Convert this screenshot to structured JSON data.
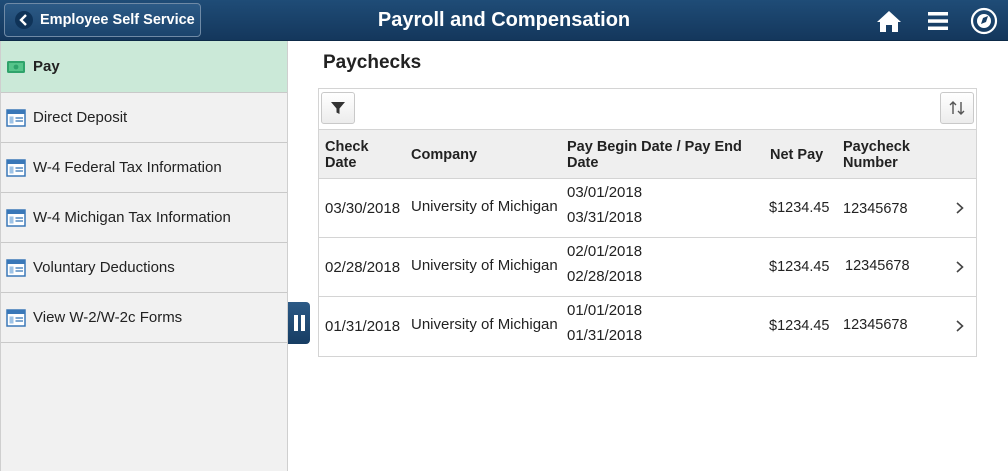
{
  "header": {
    "back_label": "Employee Self Service",
    "title": "Payroll and Compensation",
    "icons": [
      "home-icon",
      "menu-icon",
      "navbar-icon"
    ],
    "bg_color": "#1a4570"
  },
  "sidebar": {
    "items": [
      {
        "label": "Pay",
        "icon": "money-icon",
        "active": true
      },
      {
        "label": "Direct Deposit",
        "icon": "page-icon"
      },
      {
        "label": "W-4 Federal Tax Information",
        "icon": "page-icon"
      },
      {
        "label": "W-4 Michigan Tax Information",
        "icon": "page-icon"
      },
      {
        "label": "Voluntary Deductions",
        "icon": "page-icon"
      },
      {
        "label": "View W-2/W-2c Forms",
        "icon": "page-icon"
      }
    ],
    "active_color": "#cbe9d8"
  },
  "main": {
    "title": "Paychecks",
    "columns": {
      "check_date": "Check Date",
      "company": "Company",
      "pay_dates": "Pay Begin Date / Pay End Date",
      "net_pay": "Net Pay",
      "paycheck_number": "Paycheck Number"
    },
    "rows": [
      {
        "check_date": "03/30/2018",
        "company": "University of Michigan",
        "begin": "03/01/2018",
        "end": "03/31/2018",
        "net_pay": "$1234.45",
        "number": "12345678"
      },
      {
        "check_date": "02/28/2018",
        "company": "University of Michigan",
        "begin": "02/01/2018",
        "end": "02/28/2018",
        "net_pay": "$1234.45",
        "number": "12345678"
      },
      {
        "check_date": "01/31/2018",
        "company": "University of Michigan",
        "begin": "01/01/2018",
        "end": "01/31/2018",
        "net_pay": "$1234.45",
        "number": "12345678"
      }
    ]
  }
}
